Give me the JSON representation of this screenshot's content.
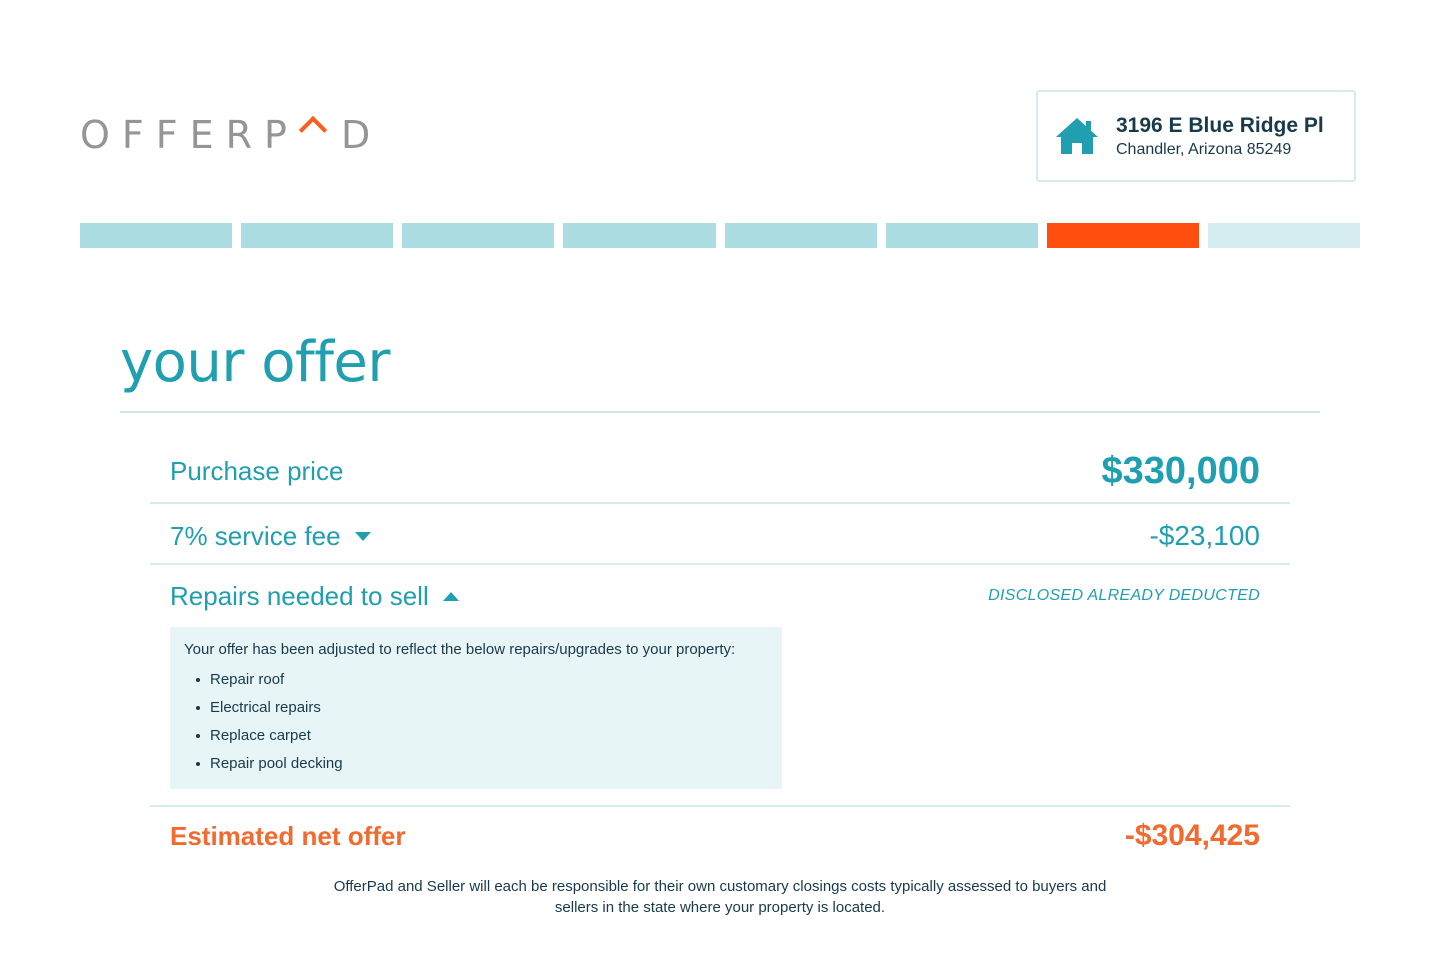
{
  "brand": {
    "logo_text_left": "OFFERP",
    "logo_text_right": "D",
    "accent_color": "#ff5a1f",
    "primary_color": "#1f9fb0"
  },
  "address": {
    "icon": "house-icon",
    "street": "3196 E Blue Ridge Pl",
    "city_state_zip": "Chandler, Arizona 85249"
  },
  "progress": {
    "total_steps": 8,
    "current_step": 7,
    "colors": {
      "completed": "#acdde3",
      "current": "#ff4e0d",
      "upcoming": "#d5edf0"
    }
  },
  "page": {
    "title": "your offer"
  },
  "offer": {
    "purchase_price": {
      "label": "Purchase price",
      "value": "$330,000"
    },
    "service_fee": {
      "label": "7% service fee",
      "value": "-$23,100",
      "expanded": false
    },
    "repairs": {
      "label": "Repairs needed to sell",
      "status": "DISCLOSED ALREADY DEDUCTED",
      "expanded": true,
      "intro": "Your offer has been adjusted to reflect the below repairs/upgrades to your property:",
      "items": [
        "Repair roof",
        "Electrical repairs",
        "Replace carpet",
        "Repair pool decking"
      ]
    },
    "net": {
      "label": "Estimated net offer",
      "value": "-$304,425"
    }
  },
  "disclaimer": "OfferPad and Seller will each be responsible for their own customary closings costs typically assessed to buyers and sellers in the state where your property is located."
}
